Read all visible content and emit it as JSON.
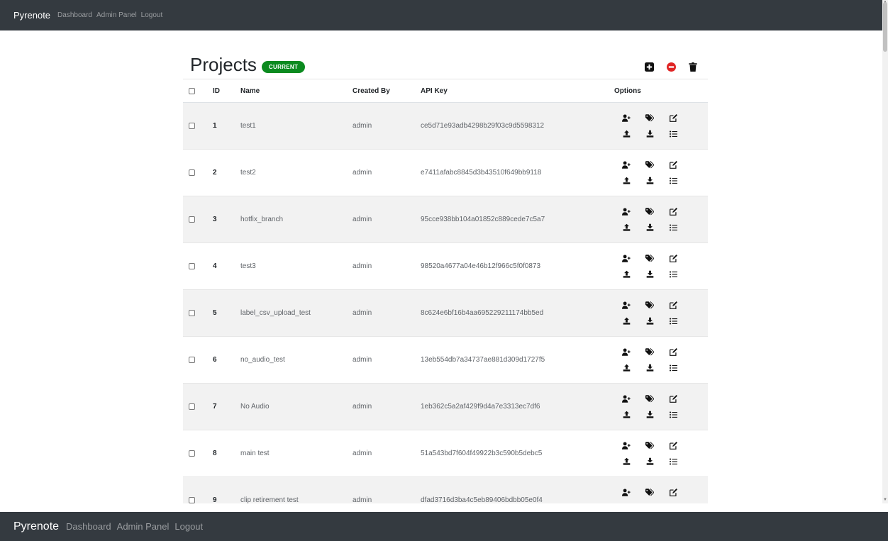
{
  "nav": {
    "brand": "Pyrenote",
    "links": [
      "Dashboard",
      "Admin Panel",
      "Logout"
    ]
  },
  "page": {
    "title": "Projects",
    "badge": "CURRENT",
    "toolbar_icons": [
      "plus-square-icon",
      "minus-circle-icon",
      "trash-icon"
    ]
  },
  "table": {
    "headers": {
      "id": "ID",
      "name": "Name",
      "created_by": "Created By",
      "api_key": "API Key",
      "options": "Options"
    },
    "rows": [
      {
        "id": "1",
        "name": "test1",
        "created_by": "admin",
        "api_key": "ce5d71e93adb4298b29f03c9d5598312"
      },
      {
        "id": "2",
        "name": "test2",
        "created_by": "admin",
        "api_key": "e7411afabc8845d3b43510f649bb9118"
      },
      {
        "id": "3",
        "name": "hotfix_branch",
        "created_by": "admin",
        "api_key": "95cce938bb104a01852c889cede7c5a7"
      },
      {
        "id": "4",
        "name": "test3",
        "created_by": "admin",
        "api_key": "98520a4677a04e46b12f966c5f0f0873"
      },
      {
        "id": "5",
        "name": "label_csv_upload_test",
        "created_by": "admin",
        "api_key": "8c624e6bf16b4aa695229211174bb5ed"
      },
      {
        "id": "6",
        "name": "no_audio_test",
        "created_by": "admin",
        "api_key": "13eb554db7a34737ae881d309d1727f5"
      },
      {
        "id": "7",
        "name": "No Audio",
        "created_by": "admin",
        "api_key": "1eb362c5a2af429f9d4a7e3313ec7df6"
      },
      {
        "id": "8",
        "name": "main test",
        "created_by": "admin",
        "api_key": "51a543bd7f604f49922b3c590b5debc5"
      },
      {
        "id": "9",
        "name": "clip retirement test",
        "created_by": "admin",
        "api_key": "dfad3716d3ba4c5eb89406bdbb05e0f4"
      }
    ],
    "option_icons": [
      "user-plus-icon",
      "tags-icon",
      "edit-icon",
      "upload-icon",
      "download-icon",
      "list-icon"
    ]
  },
  "colors": {
    "navbar": "#343a40",
    "badge": "#0b8a1f",
    "remove": "#e02424",
    "stripe": "#f2f2f2"
  }
}
